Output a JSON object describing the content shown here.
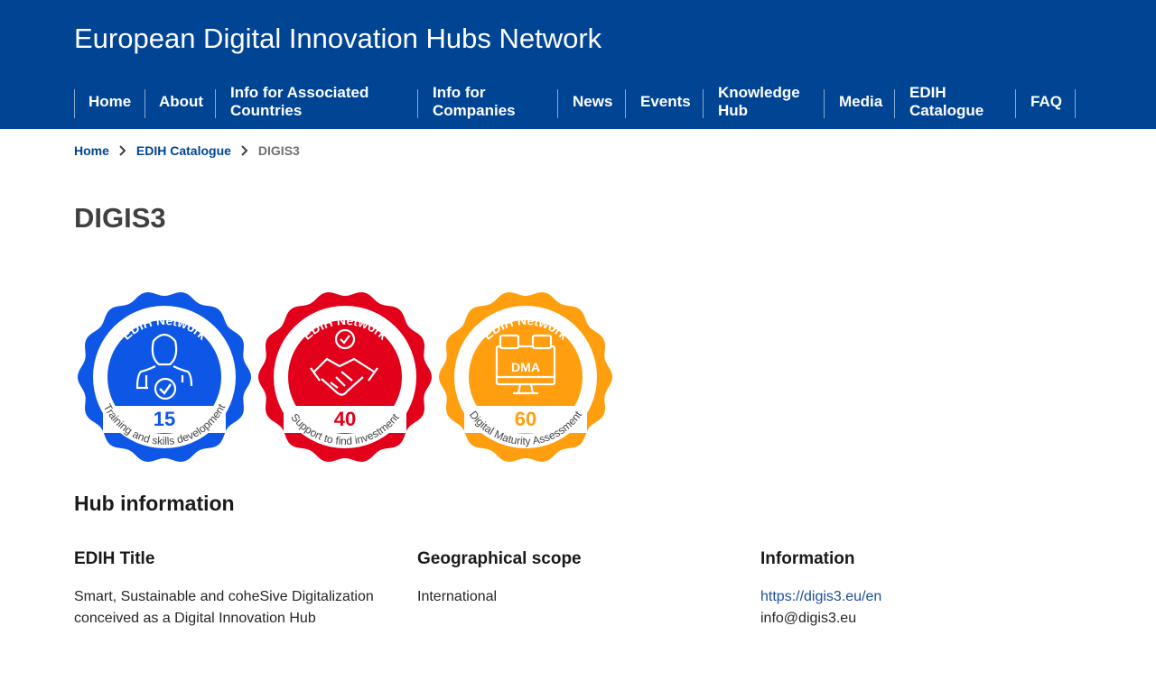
{
  "header": {
    "site_title": "European Digital Innovation Hubs Network",
    "nav": {
      "home": "Home",
      "about": "About",
      "info_assoc": "Info for Associated Countries",
      "info_companies": "Info for Companies",
      "news": "News",
      "events": "Events",
      "knowledge_hub": "Knowledge Hub",
      "media": "Media",
      "edih_catalogue": "EDIH Catalogue",
      "faq": "FAQ"
    }
  },
  "breadcrumb": {
    "home": "Home",
    "catalogue": "EDIH Catalogue",
    "current": "DIGIS3"
  },
  "page_title": "DIGIS3",
  "badges": [
    {
      "network": "EDIH Network",
      "number": "15",
      "caption": "Training and skills development",
      "color": "#0e57e6",
      "icon": "person-check-icon"
    },
    {
      "network": "EDIH Network",
      "number": "40",
      "caption": "Support to find investment",
      "color": "#e2001a",
      "icon": "handshake-icon"
    },
    {
      "network": "EDIH Network",
      "number": "60",
      "caption": "Digital Maturity Assessment",
      "color": "#ff9e0f",
      "icon": "dma-monitor-icon",
      "icon_text": "DMA"
    }
  ],
  "hub_info": {
    "section_title": "Hub information",
    "title_heading": "EDIH Title",
    "title_value": "Smart, Sustainable and coheSive Digitalization conceived as a Digital Innovation Hub",
    "scope_heading": "Geographical scope",
    "scope_value": "International",
    "info_heading": "Information",
    "website": "https://digis3.eu/en",
    "email": "info@digis3.eu"
  },
  "colors": {
    "brand": "#004494",
    "link": "#1b4e9b"
  }
}
